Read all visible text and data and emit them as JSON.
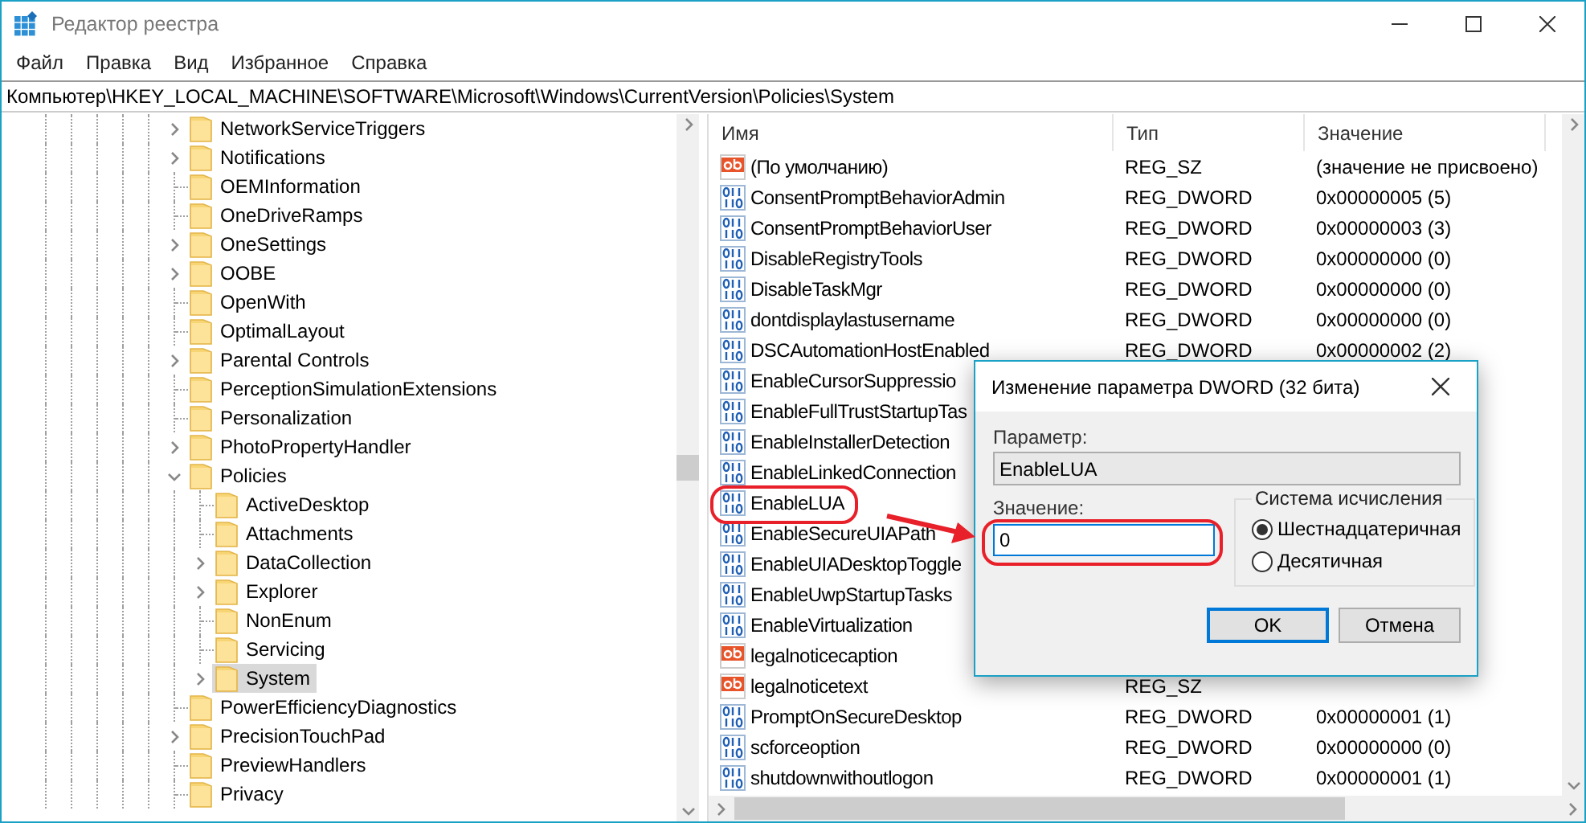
{
  "window": {
    "title": "Редактор реестра"
  },
  "menu": [
    "Файл",
    "Правка",
    "Вид",
    "Избранное",
    "Справка"
  ],
  "address": "Компьютер\\HKEY_LOCAL_MACHINE\\SOFTWARE\\Microsoft\\Windows\\CurrentVersion\\Policies\\System",
  "tree": [
    {
      "label": "NetworkServiceTriggers",
      "expanded": false,
      "selected": false
    },
    {
      "label": "Notifications",
      "expanded": false,
      "selected": false
    },
    {
      "label": "OEMInformation",
      "selected": false
    },
    {
      "label": "OneDriveRamps",
      "selected": false
    },
    {
      "label": "OneSettings",
      "expanded": false,
      "selected": false
    },
    {
      "label": "OOBE",
      "expanded": false,
      "selected": false
    },
    {
      "label": "OpenWith",
      "selected": false
    },
    {
      "label": "OptimalLayout",
      "selected": false
    },
    {
      "label": "Parental Controls",
      "expanded": false,
      "selected": false
    },
    {
      "label": "PerceptionSimulationExtensions",
      "selected": false
    },
    {
      "label": "Personalization",
      "selected": false
    },
    {
      "label": "PhotoPropertyHandler",
      "expanded": false,
      "selected": false
    },
    {
      "label": "Policies",
      "expanded": true,
      "selected": false,
      "children": [
        {
          "label": "ActiveDesktop",
          "selected": false
        },
        {
          "label": "Attachments",
          "selected": false
        },
        {
          "label": "DataCollection",
          "expanded": false,
          "selected": false
        },
        {
          "label": "Explorer",
          "expanded": false,
          "selected": false
        },
        {
          "label": "NonEnum",
          "selected": false
        },
        {
          "label": "Servicing",
          "selected": false
        },
        {
          "label": "System",
          "expanded": false,
          "selected": true
        }
      ]
    },
    {
      "label": "PowerEfficiencyDiagnostics",
      "selected": false
    },
    {
      "label": "PrecisionTouchPad",
      "expanded": false,
      "selected": false
    },
    {
      "label": "PreviewHandlers",
      "selected": false
    },
    {
      "label": "Privacy",
      "selected": false
    }
  ],
  "list": {
    "columns": [
      "Имя",
      "Тип",
      "Значение"
    ],
    "rows": [
      {
        "kind": "string",
        "name": "(По умолчанию)",
        "type": "REG_SZ",
        "value": "(значение не присвоено)"
      },
      {
        "kind": "dword",
        "name": "ConsentPromptBehaviorAdmin",
        "type": "REG_DWORD",
        "value": "0x00000005 (5)"
      },
      {
        "kind": "dword",
        "name": "ConsentPromptBehaviorUser",
        "type": "REG_DWORD",
        "value": "0x00000003 (3)"
      },
      {
        "kind": "dword",
        "name": "DisableRegistryTools",
        "type": "REG_DWORD",
        "value": "0x00000000 (0)"
      },
      {
        "kind": "dword",
        "name": "DisableTaskMgr",
        "type": "REG_DWORD",
        "value": "0x00000000 (0)"
      },
      {
        "kind": "dword",
        "name": "dontdisplaylastusername",
        "type": "REG_DWORD",
        "value": "0x00000000 (0)"
      },
      {
        "kind": "dword",
        "name": "DSCAutomationHostEnabled",
        "type": "REG_DWORD",
        "value": "0x00000002 (2)"
      },
      {
        "kind": "dword",
        "name": "EnableCursorSuppressio"
      },
      {
        "kind": "dword",
        "name": "EnableFullTrustStartupTas"
      },
      {
        "kind": "dword",
        "name": "EnableInstallerDetection"
      },
      {
        "kind": "dword",
        "name": "EnableLinkedConnection"
      },
      {
        "kind": "dword",
        "name": "EnableLUA"
      },
      {
        "kind": "dword",
        "name": "EnableSecureUIAPath"
      },
      {
        "kind": "dword",
        "name": "EnableUIADesktopToggle"
      },
      {
        "kind": "dword",
        "name": "EnableUwpStartupTasks"
      },
      {
        "kind": "dword",
        "name": "EnableVirtualization"
      },
      {
        "kind": "string",
        "name": "legalnoticecaption"
      },
      {
        "kind": "string",
        "name": "legalnoticetext",
        "type": "REG_SZ"
      },
      {
        "kind": "dword",
        "name": "PromptOnSecureDesktop",
        "type": "REG_DWORD",
        "value": "0x00000001 (1)"
      },
      {
        "kind": "dword",
        "name": "scforceoption",
        "type": "REG_DWORD",
        "value": "0x00000000 (0)"
      },
      {
        "kind": "dword",
        "name": "shutdownwithoutlogon",
        "type": "REG_DWORD",
        "value": "0x00000001 (1)"
      }
    ]
  },
  "dialog": {
    "title": "Изменение параметра DWORD (32 бита)",
    "param_label": "Параметр:",
    "param_value": "EnableLUA",
    "value_label": "Значение:",
    "value": "0",
    "base": {
      "title": "Система исчисления",
      "options": [
        {
          "label": "Шестнадцатеричная",
          "selected": true
        },
        {
          "label": "Десятичная",
          "selected": false
        }
      ]
    },
    "buttons": [
      {
        "label": "OK",
        "default": true
      },
      {
        "label": "Отмена",
        "default": false
      }
    ]
  }
}
